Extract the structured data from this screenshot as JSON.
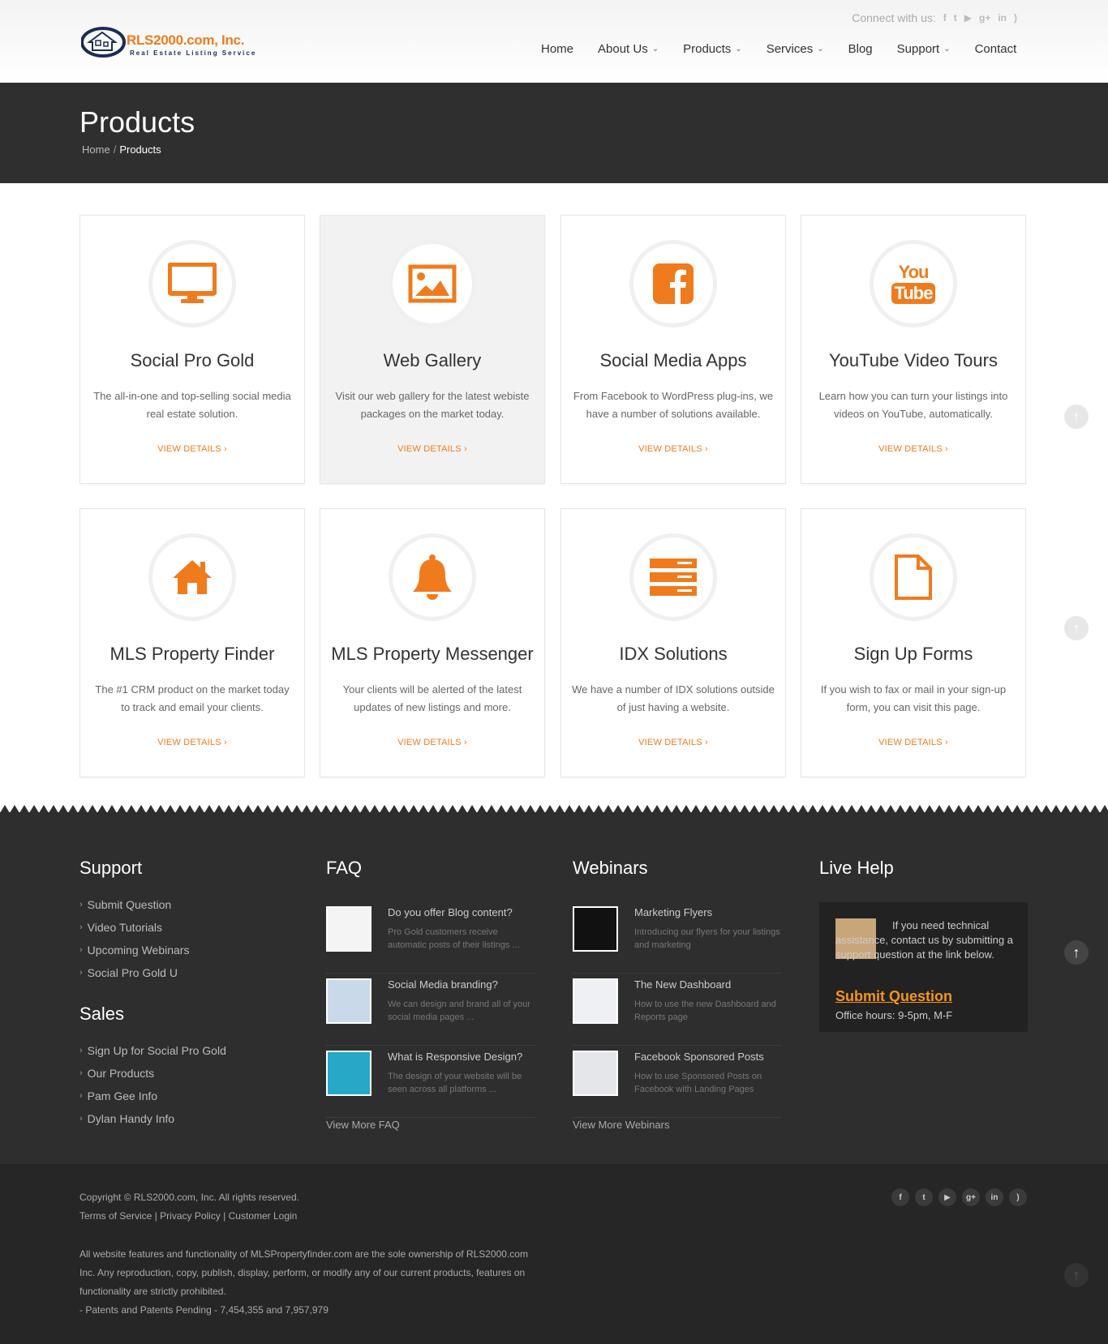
{
  "header": {
    "logo_text": "RLS2000.com, Inc.",
    "logo_tagline": "Real Estate Listing Service",
    "connect_label": "Connect with us:",
    "social_icons": [
      "facebook-icon",
      "twitter-icon",
      "youtube-icon",
      "google-plus-icon",
      "linkedin-icon",
      "rss-icon"
    ],
    "social_glyphs": {
      "facebook": "f",
      "twitter": "t",
      "youtube": "▶",
      "googleplus": "g+",
      "linkedin": "in",
      "rss": ")"
    }
  },
  "nav": [
    {
      "label": "Home",
      "dropdown": false
    },
    {
      "label": "About Us",
      "dropdown": true
    },
    {
      "label": "Products",
      "dropdown": true
    },
    {
      "label": "Services",
      "dropdown": true
    },
    {
      "label": "Blog",
      "dropdown": false
    },
    {
      "label": "Support",
      "dropdown": true
    },
    {
      "label": "Contact",
      "dropdown": false
    }
  ],
  "page": {
    "title": "Products",
    "breadcrumb": [
      "Home",
      "Products"
    ],
    "breadcrumb_sep": "/"
  },
  "colors": {
    "accent": "#f07b1d",
    "footer_bg": "#2e2e2e",
    "band_bg": "#2f2f2f"
  },
  "products": [
    {
      "title": "Social Pro Gold",
      "desc": "The all-in-one and top-selling social media real estate solution.",
      "cta": "VIEW DETAILS ›",
      "icon": "monitor-icon"
    },
    {
      "title": "Web Gallery",
      "desc": "Visit our web gallery for the latest webiste packages on the market today.",
      "cta": "VIEW DETAILS ›",
      "icon": "image-icon"
    },
    {
      "title": "Social Media Apps",
      "desc": "From Facebook to WordPress plug-ins, we have a number of solutions available.",
      "cta": "VIEW DETAILS ›",
      "icon": "facebook-icon"
    },
    {
      "title": "YouTube Video Tours",
      "desc": "Learn how you can turn your listings into videos on YouTube, automatically.",
      "cta": "VIEW DETAILS ›",
      "icon": "youtube-icon",
      "icon_text_top": "You",
      "icon_text_bottom": "Tube"
    },
    {
      "title": "MLS Property Finder",
      "desc": "The #1 CRM product on the market today to track and email your clients.",
      "cta": "VIEW DETAILS ›",
      "icon": "home-icon"
    },
    {
      "title": "MLS Property Messenger",
      "desc": "Your clients will be alerted of the latest updates of new listings and more.",
      "cta": "VIEW DETAILS ›",
      "icon": "bell-icon"
    },
    {
      "title": "IDX Solutions",
      "desc": "We have a number of IDX solutions outside of just having a website.",
      "cta": "VIEW DETAILS ›",
      "icon": "server-icon"
    },
    {
      "title": "Sign Up Forms",
      "desc": "If you wish to fax or mail in your sign-up form, you can visit this page.",
      "cta": "VIEW DETAILS ›",
      "icon": "document-icon"
    }
  ],
  "footer": {
    "support": {
      "heading": "Support",
      "links": [
        "Submit Question",
        "Video Tutorials",
        "Upcoming Webinars",
        "Social Pro Gold U"
      ]
    },
    "sales": {
      "heading": "Sales",
      "links": [
        "Sign Up for Social Pro Gold",
        "Our Products",
        "Pam Gee Info",
        "Dylan Handy Info"
      ]
    },
    "faq": {
      "heading": "FAQ",
      "items": [
        {
          "title": "Do you offer Blog content?",
          "desc": "Pro Gold customers receive automatic posts of their listings ..."
        },
        {
          "title": "Social Media branding?",
          "desc": "We can design and brand all of your social media pages ..."
        },
        {
          "title": "What is Responsive Design?",
          "desc": "The design of your website will be seen across all platforms ..."
        }
      ],
      "more": "View More FAQ"
    },
    "webinars": {
      "heading": "Webinars",
      "items": [
        {
          "title": "Marketing Flyers",
          "desc": "Introducing our flyers for your listings and marketing"
        },
        {
          "title": "The New Dashboard",
          "desc": "How to use the new Dashboard and Reports page"
        },
        {
          "title": "Facebook Sponsored Posts",
          "desc": "How to use Sponsored Posts on Facebook with Landing Pages"
        }
      ],
      "more": "View More Webinars"
    },
    "live_help": {
      "heading": "Live Help",
      "text": "If you need technical assistance, contact us by submitting a support question at the link below.",
      "link": "Submit Question",
      "hours": "Office hours: 9-5pm, M-F"
    }
  },
  "bottom": {
    "copyright": "Copyright © RLS2000.com, Inc. All rights reserved.",
    "links": [
      "Terms of Service",
      "Privacy Policy",
      "Customer Login"
    ],
    "legal": "All website features and functionality of MLSPropertyfinder.com are the sole ownership of RLS2000.com Inc. Any reproduction, copy, publish, display, perform, or modify any of our current products, features on functionality are strictly prohibited.",
    "patents": "- Patents and Patents Pending - 7,454,355 and 7,957,979"
  }
}
